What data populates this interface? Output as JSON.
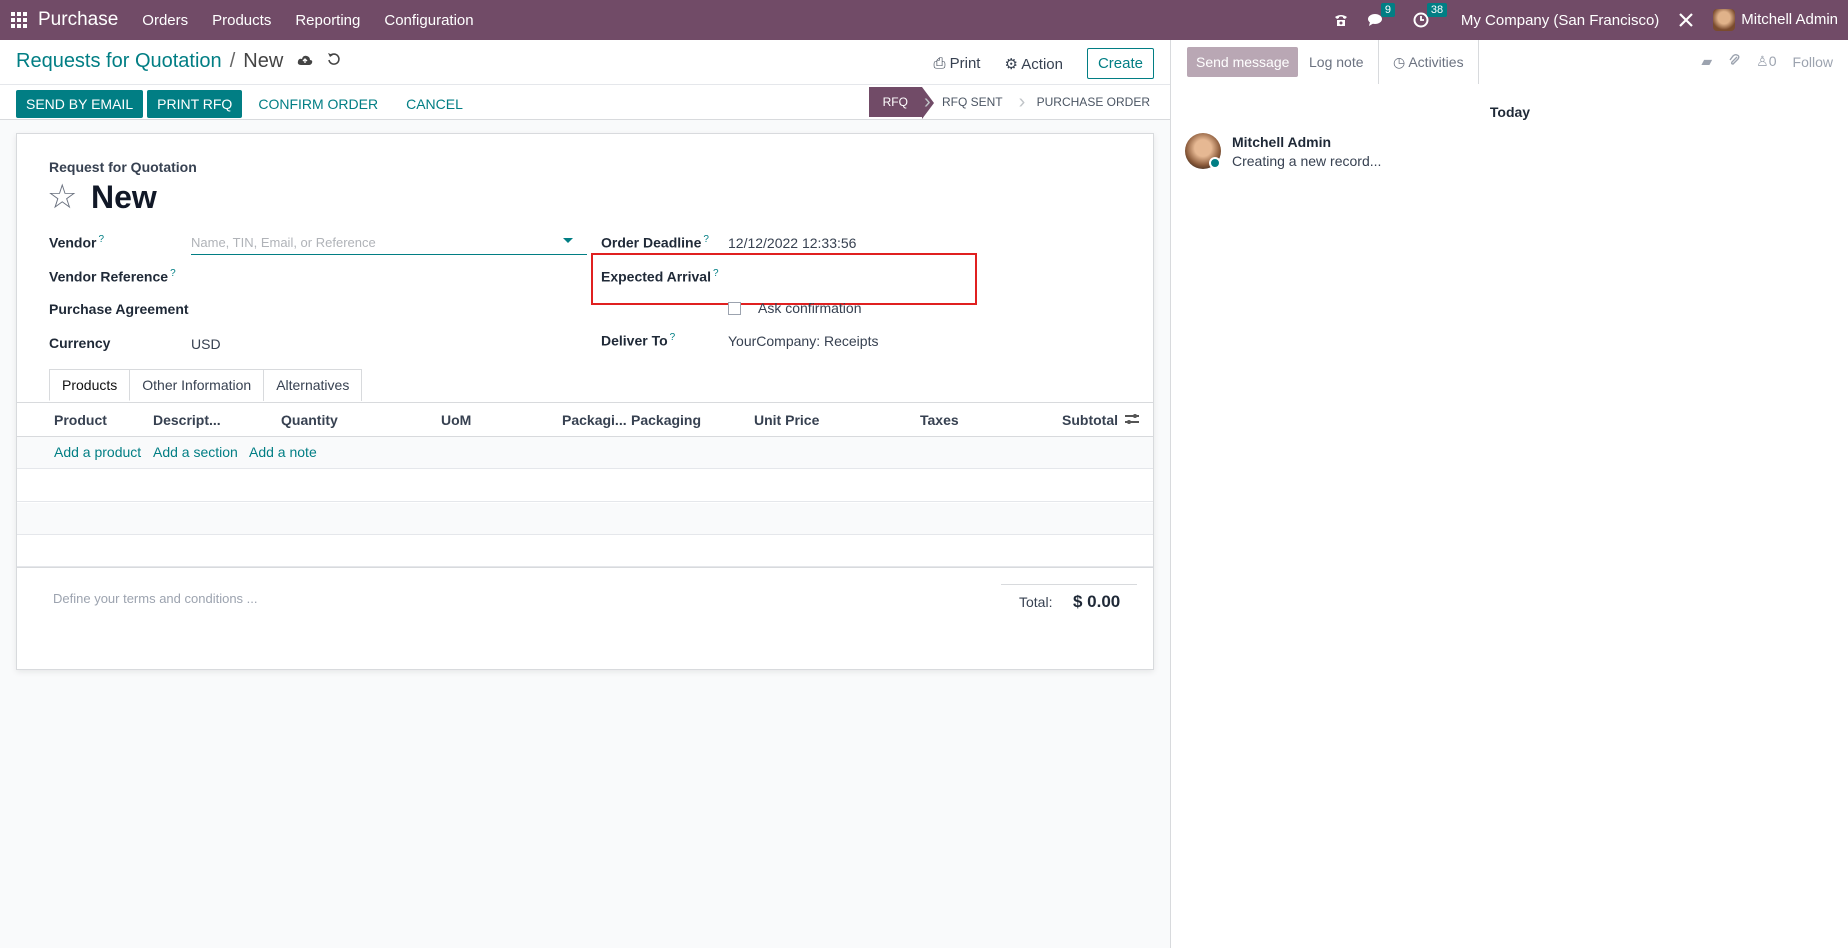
{
  "navbar": {
    "app_name": "Purchase",
    "menus": [
      "Orders",
      "Products",
      "Reporting",
      "Configuration"
    ],
    "messages_count": "9",
    "activities_count": "38",
    "company": "My Company (San Francisco)",
    "user": "Mitchell Admin"
  },
  "control": {
    "breadcrumb_parent": "Requests for Quotation",
    "breadcrumb_current": "New",
    "print_label": "Print",
    "action_label": "Action",
    "create_label": "Create",
    "buttons": {
      "send_email": "SEND BY EMAIL",
      "print_rfq": "PRINT RFQ",
      "confirm": "CONFIRM ORDER",
      "cancel": "CANCEL"
    },
    "stages": [
      "RFQ",
      "RFQ SENT",
      "PURCHASE ORDER"
    ],
    "active_stage": "RFQ"
  },
  "form": {
    "heading": "Request for Quotation",
    "title": "New",
    "vendor_label": "Vendor",
    "vendor_placeholder": "Name, TIN, Email, or Reference",
    "vendor_ref_label": "Vendor Reference",
    "agreement_label": "Purchase Agreement",
    "currency_label": "Currency",
    "currency_value": "USD",
    "deadline_label": "Order Deadline",
    "deadline_value": "12/12/2022 12:33:56",
    "arrival_label": "Expected Arrival",
    "ask_confirmation": "Ask confirmation",
    "deliver_label": "Deliver To",
    "deliver_value": "YourCompany: Receipts",
    "help_mark": "?",
    "tabs": [
      "Products",
      "Other Information",
      "Alternatives"
    ],
    "columns": [
      "Product",
      "Descript...",
      "Quantity",
      "UoM",
      "Packagi...",
      "Packaging",
      "Unit Price",
      "Taxes",
      "Subtotal"
    ],
    "add_product": "Add a product",
    "add_section": "Add a section",
    "add_note": "Add a note",
    "terms_placeholder": "Define your terms and conditions ...",
    "total_label": "Total:",
    "total_value": "$ 0.00"
  },
  "chatter": {
    "send_message": "Send message",
    "log_note": "Log note",
    "activities": "Activities",
    "followers_count": "0",
    "follow": "Follow",
    "day": "Today",
    "author": "Mitchell Admin",
    "message": "Creating a new record..."
  },
  "colors": {
    "brand": "#714b67",
    "accent": "#017e84",
    "highlight": "#e02020"
  }
}
